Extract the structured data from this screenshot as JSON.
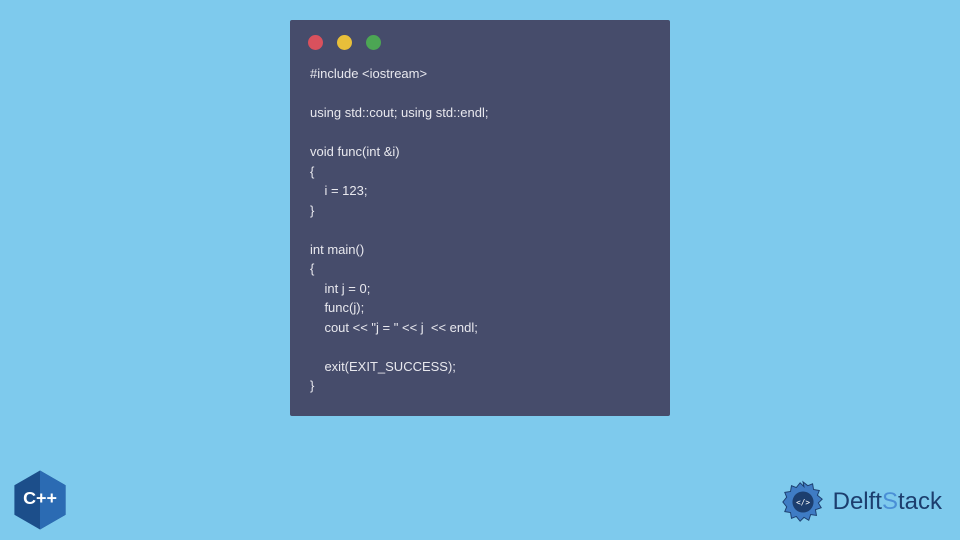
{
  "code": {
    "lines": [
      "#include <iostream>",
      "",
      "using std::cout; using std::endl;",
      "",
      "void func(int &i)",
      "{",
      "    i = 123;",
      "}",
      "",
      "int main()",
      "{",
      "    int j = 0;",
      "    func(j);",
      "    cout << \"j = \" << j  << endl;",
      "",
      "    exit(EXIT_SUCCESS);",
      "}"
    ]
  },
  "brand": {
    "name": "DelftStack"
  },
  "badge": {
    "label": "C++"
  },
  "colors": {
    "page_bg": "#7ecaed",
    "window_bg": "#464c6b",
    "dot_red": "#d9515d",
    "dot_yellow": "#e8bf3a",
    "dot_green": "#4ca654",
    "brand_primary": "#1c3e6e",
    "brand_accent": "#4a8fd6"
  }
}
